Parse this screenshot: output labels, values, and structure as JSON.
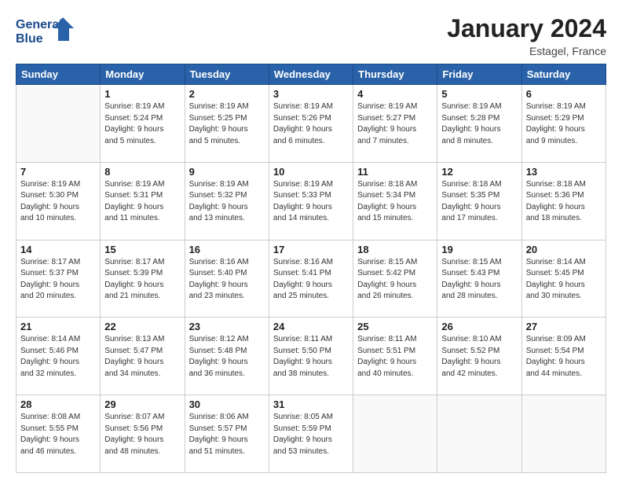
{
  "header": {
    "logo_line1": "General",
    "logo_line2": "Blue",
    "month": "January 2024",
    "location": "Estagel, France"
  },
  "weekdays": [
    "Sunday",
    "Monday",
    "Tuesday",
    "Wednesday",
    "Thursday",
    "Friday",
    "Saturday"
  ],
  "weeks": [
    [
      {
        "day": "",
        "info": ""
      },
      {
        "day": "1",
        "info": "Sunrise: 8:19 AM\nSunset: 5:24 PM\nDaylight: 9 hours\nand 5 minutes."
      },
      {
        "day": "2",
        "info": "Sunrise: 8:19 AM\nSunset: 5:25 PM\nDaylight: 9 hours\nand 5 minutes."
      },
      {
        "day": "3",
        "info": "Sunrise: 8:19 AM\nSunset: 5:26 PM\nDaylight: 9 hours\nand 6 minutes."
      },
      {
        "day": "4",
        "info": "Sunrise: 8:19 AM\nSunset: 5:27 PM\nDaylight: 9 hours\nand 7 minutes."
      },
      {
        "day": "5",
        "info": "Sunrise: 8:19 AM\nSunset: 5:28 PM\nDaylight: 9 hours\nand 8 minutes."
      },
      {
        "day": "6",
        "info": "Sunrise: 8:19 AM\nSunset: 5:29 PM\nDaylight: 9 hours\nand 9 minutes."
      }
    ],
    [
      {
        "day": "7",
        "info": "Sunrise: 8:19 AM\nSunset: 5:30 PM\nDaylight: 9 hours\nand 10 minutes."
      },
      {
        "day": "8",
        "info": "Sunrise: 8:19 AM\nSunset: 5:31 PM\nDaylight: 9 hours\nand 11 minutes."
      },
      {
        "day": "9",
        "info": "Sunrise: 8:19 AM\nSunset: 5:32 PM\nDaylight: 9 hours\nand 13 minutes."
      },
      {
        "day": "10",
        "info": "Sunrise: 8:19 AM\nSunset: 5:33 PM\nDaylight: 9 hours\nand 14 minutes."
      },
      {
        "day": "11",
        "info": "Sunrise: 8:18 AM\nSunset: 5:34 PM\nDaylight: 9 hours\nand 15 minutes."
      },
      {
        "day": "12",
        "info": "Sunrise: 8:18 AM\nSunset: 5:35 PM\nDaylight: 9 hours\nand 17 minutes."
      },
      {
        "day": "13",
        "info": "Sunrise: 8:18 AM\nSunset: 5:36 PM\nDaylight: 9 hours\nand 18 minutes."
      }
    ],
    [
      {
        "day": "14",
        "info": "Sunrise: 8:17 AM\nSunset: 5:37 PM\nDaylight: 9 hours\nand 20 minutes."
      },
      {
        "day": "15",
        "info": "Sunrise: 8:17 AM\nSunset: 5:39 PM\nDaylight: 9 hours\nand 21 minutes."
      },
      {
        "day": "16",
        "info": "Sunrise: 8:16 AM\nSunset: 5:40 PM\nDaylight: 9 hours\nand 23 minutes."
      },
      {
        "day": "17",
        "info": "Sunrise: 8:16 AM\nSunset: 5:41 PM\nDaylight: 9 hours\nand 25 minutes."
      },
      {
        "day": "18",
        "info": "Sunrise: 8:15 AM\nSunset: 5:42 PM\nDaylight: 9 hours\nand 26 minutes."
      },
      {
        "day": "19",
        "info": "Sunrise: 8:15 AM\nSunset: 5:43 PM\nDaylight: 9 hours\nand 28 minutes."
      },
      {
        "day": "20",
        "info": "Sunrise: 8:14 AM\nSunset: 5:45 PM\nDaylight: 9 hours\nand 30 minutes."
      }
    ],
    [
      {
        "day": "21",
        "info": "Sunrise: 8:14 AM\nSunset: 5:46 PM\nDaylight: 9 hours\nand 32 minutes."
      },
      {
        "day": "22",
        "info": "Sunrise: 8:13 AM\nSunset: 5:47 PM\nDaylight: 9 hours\nand 34 minutes."
      },
      {
        "day": "23",
        "info": "Sunrise: 8:12 AM\nSunset: 5:48 PM\nDaylight: 9 hours\nand 36 minutes."
      },
      {
        "day": "24",
        "info": "Sunrise: 8:11 AM\nSunset: 5:50 PM\nDaylight: 9 hours\nand 38 minutes."
      },
      {
        "day": "25",
        "info": "Sunrise: 8:11 AM\nSunset: 5:51 PM\nDaylight: 9 hours\nand 40 minutes."
      },
      {
        "day": "26",
        "info": "Sunrise: 8:10 AM\nSunset: 5:52 PM\nDaylight: 9 hours\nand 42 minutes."
      },
      {
        "day": "27",
        "info": "Sunrise: 8:09 AM\nSunset: 5:54 PM\nDaylight: 9 hours\nand 44 minutes."
      }
    ],
    [
      {
        "day": "28",
        "info": "Sunrise: 8:08 AM\nSunset: 5:55 PM\nDaylight: 9 hours\nand 46 minutes."
      },
      {
        "day": "29",
        "info": "Sunrise: 8:07 AM\nSunset: 5:56 PM\nDaylight: 9 hours\nand 48 minutes."
      },
      {
        "day": "30",
        "info": "Sunrise: 8:06 AM\nSunset: 5:57 PM\nDaylight: 9 hours\nand 51 minutes."
      },
      {
        "day": "31",
        "info": "Sunrise: 8:05 AM\nSunset: 5:59 PM\nDaylight: 9 hours\nand 53 minutes."
      },
      {
        "day": "",
        "info": ""
      },
      {
        "day": "",
        "info": ""
      },
      {
        "day": "",
        "info": ""
      }
    ]
  ]
}
